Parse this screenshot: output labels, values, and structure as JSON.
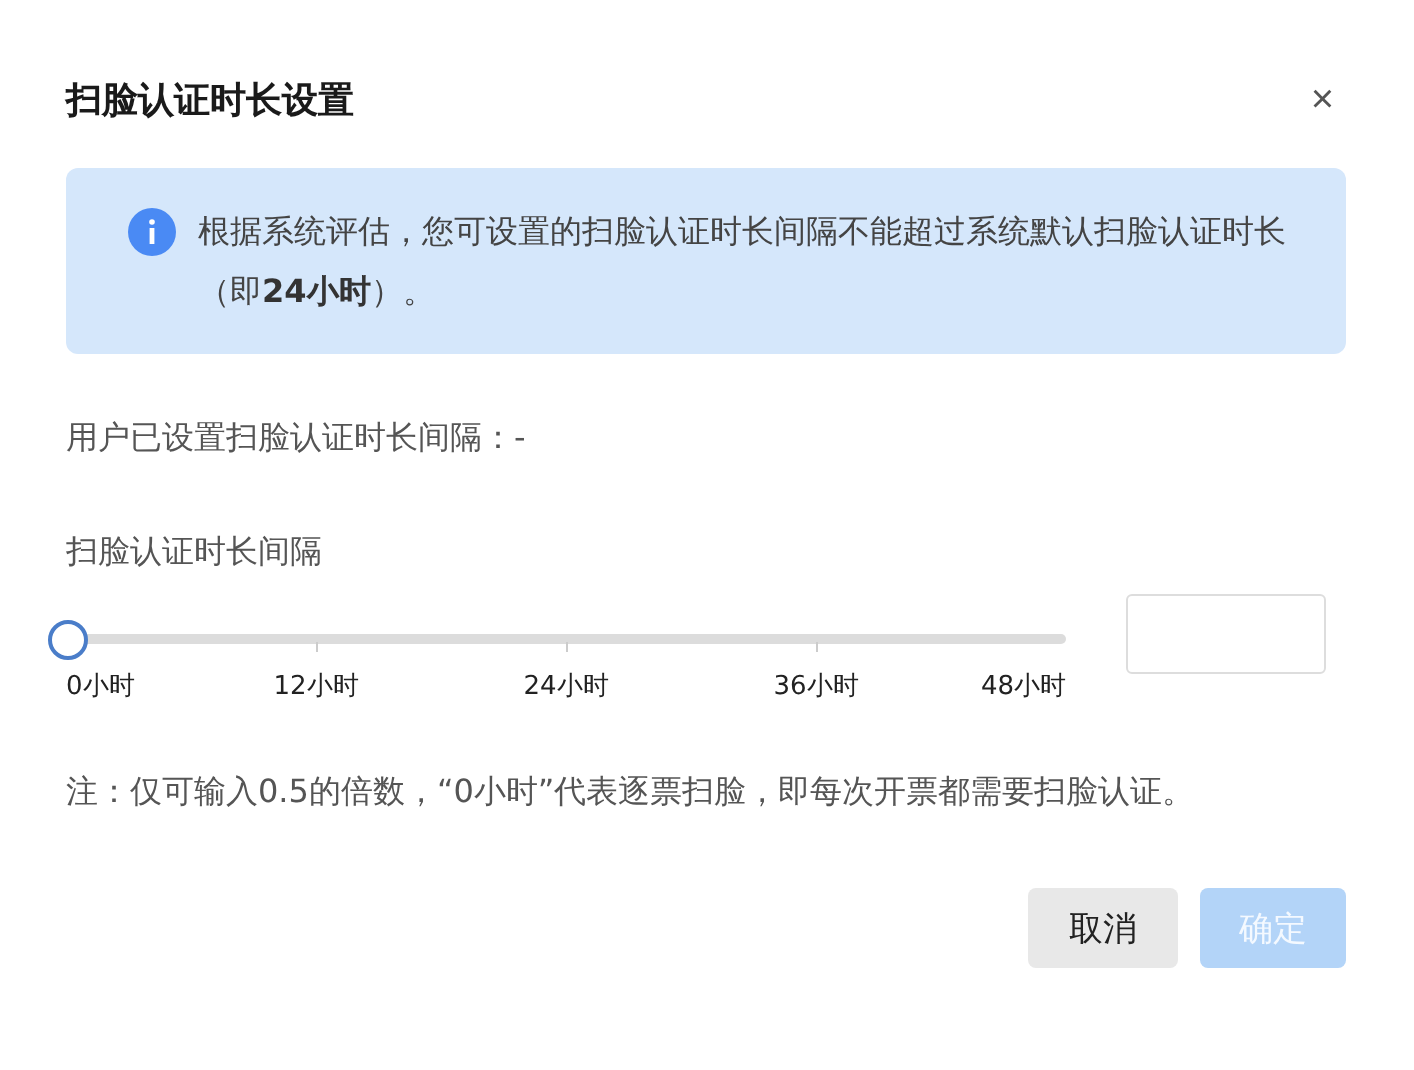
{
  "dialog": {
    "title": "扫脸认证时长设置",
    "close": "×"
  },
  "alert": {
    "text": "根据系统评估，您可设置的扫脸认证时长间隔不能超过系统默认扫脸认证时长（即**24小时**）。"
  },
  "current_setting": "用户已设置扫脸认证时长间隔：-",
  "slider": {
    "label": "扫脸认证时长间隔",
    "level": 0,
    "marks": [
      "0小时",
      "12小时",
      "24小时",
      "36小时",
      "48小时"
    ]
  },
  "note": "注：仅可输入0.5的倍数，“0小时”代表逐票扫脸，即每次开票都需要扫脸认证。",
  "buttons": [
    {
      "label": "取消",
      "kind": "secondary",
      "disabled": false
    },
    {
      "label": "确定",
      "kind": "primary",
      "disabled": true
    }
  ]
}
